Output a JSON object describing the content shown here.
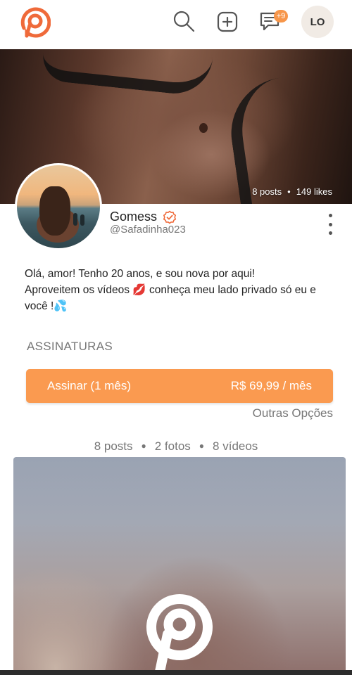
{
  "header": {
    "logo_icon": "brand-logo-icon",
    "search_icon": "search-icon",
    "add_icon": "plus-square-icon",
    "messages_icon": "chat-icon",
    "messages_badge": "+9",
    "avatar_initials": "LO"
  },
  "profile": {
    "stats": {
      "posts": "8 posts",
      "likes": "149 likes"
    },
    "name": "Gomess",
    "handle": "@Safadinha023",
    "bio_line1": "Olá, amor! Tenho 20 anos, e sou nova por aqui!",
    "bio_line2": "Aproveitem os vídeos 💋 conheça meu lado privado só eu e você !💦"
  },
  "subscriptions": {
    "title": "ASSINATURAS",
    "button_label": "Assinar (1 mês)",
    "button_price": "R$ 69,99 / mês",
    "other_options": "Outras Opções"
  },
  "content_counts": {
    "posts": "8 posts",
    "photos": "2 fotos",
    "videos": "8 vídeos"
  },
  "colors": {
    "accent": "#fa9a50",
    "brand": "#ef6a3a",
    "badge": "#f7964a",
    "muted_text": "#777777"
  }
}
